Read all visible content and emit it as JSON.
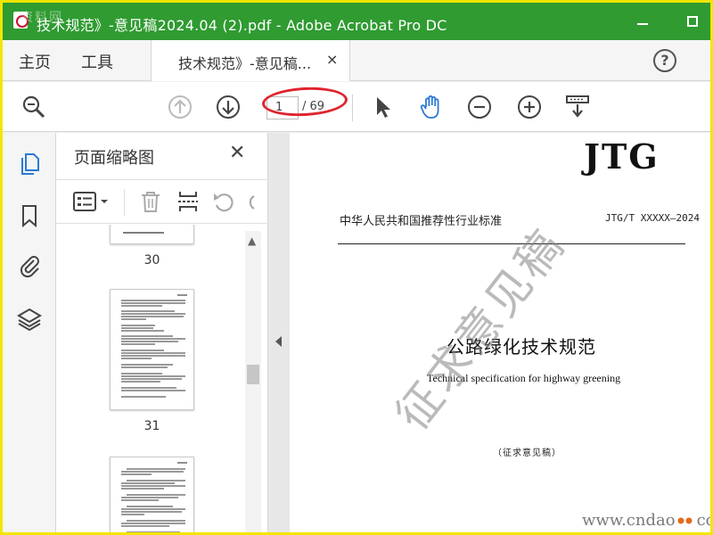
{
  "window": {
    "title": "技术规范》-意见稿2024.04 (2).pdf - Adobe Acrobat Pro DC",
    "corner_watermark": "资料网"
  },
  "menu": {
    "home": "主页",
    "tools": "工具",
    "doc_tab": "技术规范》-意见稿...",
    "close_glyph": "×",
    "help_glyph": "?"
  },
  "toolbar": {
    "current_page": "1",
    "total_pages": "/ 69",
    "icons": [
      "zoom-search-icon",
      "page-up-icon",
      "page-down-icon",
      "select-arrow-icon",
      "hand-tool-icon",
      "zoom-out-icon",
      "zoom-in-icon",
      "scroll-mode-icon"
    ]
  },
  "panel": {
    "title": "页面缩略图",
    "close_glyph": "✕",
    "thumb_labels": [
      "30",
      "31"
    ]
  },
  "document": {
    "logo": "JTG",
    "category": "中华人民共和国推荐性行业标准",
    "code": "JTG/T XXXXX—2024",
    "title": "公路绿化技术规范",
    "subtitle": "Technical specification for highway greening",
    "note": "（征求意见稿）",
    "watermark": "征求意见稿",
    "site_watermark_left": "www.cndao",
    "site_watermark_right": "com"
  },
  "colors": {
    "titlebar": "#2f9b31",
    "frame": "#f2e600",
    "active_tool": "#2a7ad5",
    "annotation_oval": "#e0232e"
  }
}
